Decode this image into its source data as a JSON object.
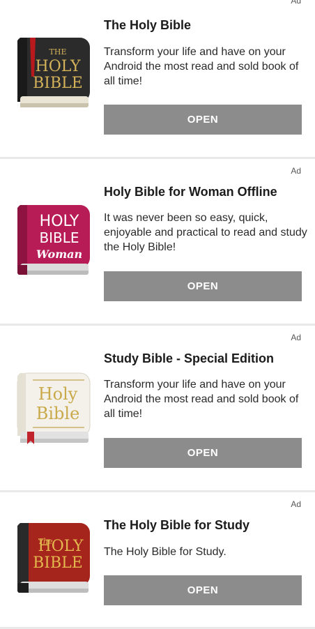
{
  "ads": [
    {
      "badge": "Ad",
      "title": "The Holy Bible",
      "description": "Transform your life and have on your Android the most read and sold book of all time!",
      "button": "OPEN",
      "icon": "holy-bible-black-book-icon",
      "icon_text": [
        "THE",
        "HOLY",
        "BIBLE"
      ]
    },
    {
      "badge": "Ad",
      "title": "Holy Bible for Woman Offline",
      "description": "It was never been so easy, quick, enjoyable and practical to read and study the Holy Bible!",
      "button": "OPEN",
      "icon": "holy-bible-woman-pink-book-icon",
      "icon_text": [
        "HOLY",
        "BIBLE",
        "Woman"
      ]
    },
    {
      "badge": "Ad",
      "title": "Study Bible - Special Edition",
      "description": "Transform your life and have on your Android the most read and sold book of all time!",
      "button": "OPEN",
      "icon": "study-bible-white-book-icon",
      "icon_text": [
        "Holy",
        "Bible"
      ]
    },
    {
      "badge": "Ad",
      "title": "The Holy Bible for Study",
      "description": "The Holy Bible for Study.",
      "button": "OPEN",
      "icon": "holy-bible-red-book-icon",
      "icon_text": [
        "The",
        "HOLY",
        "BIBLE"
      ]
    }
  ],
  "colors": {
    "button_bg": "#8c8c8c",
    "button_text": "#ffffff",
    "divider": "#e9e9e9"
  }
}
